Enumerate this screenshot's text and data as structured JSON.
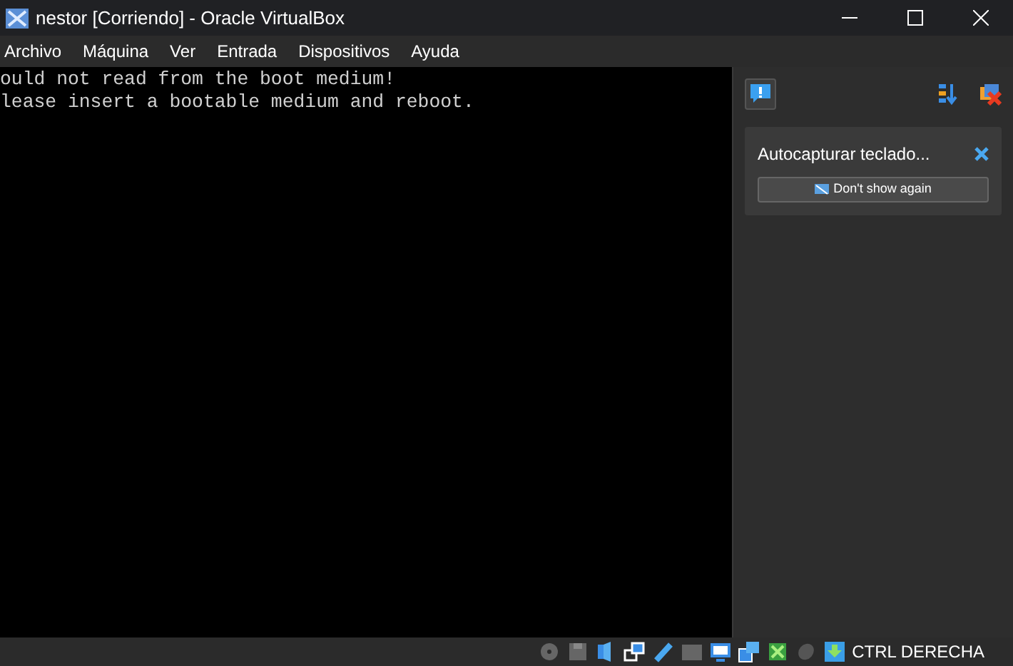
{
  "window": {
    "title": "nestor [Corriendo] - Oracle VirtualBox"
  },
  "menu": [
    "Archivo",
    "Máquina",
    "Ver",
    "Entrada",
    "Dispositivos",
    "Ayuda"
  ],
  "console": [
    "ould not read from the boot medium!",
    "lease insert a bootable medium and reboot."
  ],
  "notification": {
    "message": "Autocapturar teclado...",
    "button": "Don't show again"
  },
  "status_bar": {
    "host_key": "CTRL DERECHA"
  }
}
